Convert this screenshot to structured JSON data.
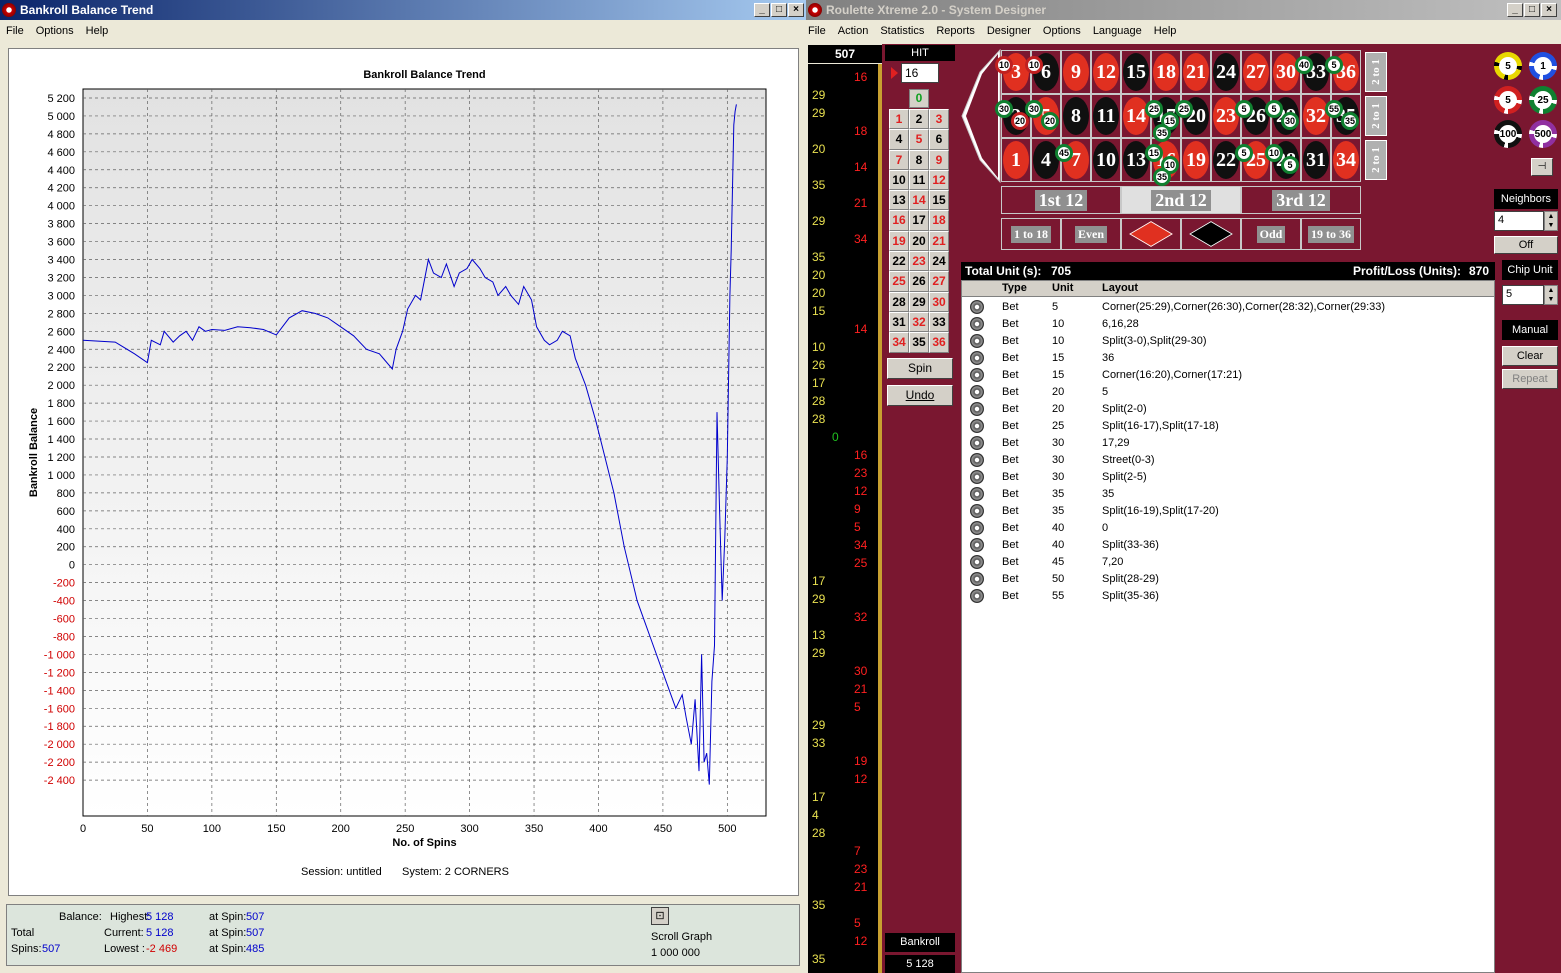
{
  "left_window": {
    "title": "Bankroll Balance Trend",
    "menu": [
      "File",
      "Options",
      "Help"
    ]
  },
  "chart_data": {
    "type": "line",
    "title": "Bankroll Balance Trend",
    "xlabel": "No. of Spins",
    "ylabel": "Bankroll Balance",
    "xlim": [
      0,
      530
    ],
    "ylim": [
      -2800,
      5300
    ],
    "xticks": [
      "0",
      "50",
      "100",
      "150",
      "200",
      "250",
      "300",
      "350",
      "400",
      "450",
      "500"
    ],
    "yticks": [
      "5 200",
      "5 000",
      "4 800",
      "4 600",
      "4 400",
      "4 200",
      "4 000",
      "3 800",
      "3 600",
      "3 400",
      "3 200",
      "3 000",
      "2 800",
      "2 600",
      "2 400",
      "2 200",
      "2 000",
      "1 800",
      "1 600",
      "1 400",
      "1 200",
      "1 000",
      "800",
      "600",
      "400",
      "200",
      "0",
      "-200",
      "-400",
      "-600",
      "-800",
      "-1 000",
      "-1 200",
      "-1 400",
      "-1 600",
      "-1 800",
      "-2 000",
      "-2 200",
      "-2 400"
    ],
    "ytick_values": [
      5200,
      5000,
      4800,
      4600,
      4400,
      4200,
      4000,
      3800,
      3600,
      3400,
      3200,
      3000,
      2800,
      2600,
      2400,
      2200,
      2000,
      1800,
      1600,
      1400,
      1200,
      1000,
      800,
      600,
      400,
      200,
      0,
      -200,
      -400,
      -600,
      -800,
      -1000,
      -1200,
      -1400,
      -1600,
      -1800,
      -2000,
      -2200,
      -2400
    ],
    "grid": true,
    "series": [
      {
        "color": "#0000cc",
        "x": [
          0,
          25,
          40,
          50,
          53,
          60,
          63,
          70,
          75,
          80,
          85,
          90,
          95,
          100,
          110,
          120,
          130,
          140,
          150,
          160,
          170,
          180,
          190,
          200,
          210,
          220,
          230,
          240,
          243,
          248,
          252,
          258,
          262,
          268,
          272,
          278,
          282,
          288,
          292,
          298,
          302,
          308,
          312,
          318,
          322,
          328,
          332,
          338,
          342,
          348,
          352,
          358,
          362,
          368,
          372,
          378,
          382,
          390,
          398,
          405,
          412,
          420,
          430,
          440,
          450,
          455,
          460,
          465,
          468,
          472,
          475,
          478,
          480,
          482,
          484,
          486,
          488,
          490,
          492,
          494,
          496,
          498,
          500,
          502,
          503,
          504,
          505,
          506,
          507
        ],
        "y": [
          2500,
          2480,
          2350,
          2250,
          2500,
          2450,
          2600,
          2480,
          2550,
          2600,
          2500,
          2650,
          2600,
          2620,
          2610,
          2650,
          2640,
          2620,
          2560,
          2750,
          2830,
          2800,
          2750,
          2650,
          2550,
          2400,
          2350,
          2180,
          2400,
          2600,
          2850,
          3000,
          2950,
          3400,
          3250,
          3200,
          3350,
          3100,
          3250,
          3300,
          3400,
          3300,
          3200,
          3150,
          3000,
          3100,
          3000,
          2900,
          3100,
          2950,
          2650,
          2500,
          2450,
          2500,
          2600,
          2550,
          2300,
          2000,
          1600,
          1200,
          800,
          200,
          -400,
          -800,
          -1200,
          -1400,
          -1600,
          -1450,
          -1700,
          -2000,
          -1500,
          -2300,
          -1000,
          -2200,
          -2100,
          -2450,
          -1300,
          -900,
          1700,
          600,
          -400,
          300,
          1200,
          3000,
          3500,
          4200,
          4900,
          5050,
          5128
        ]
      }
    ]
  },
  "session_line": {
    "session": "Session: untitled",
    "system": "System: 2 CORNERS"
  },
  "stats": {
    "balance_label": "Balance:",
    "highest_label": "Highest:",
    "highest": "5 128",
    "highest_at_label": "at Spin:",
    "highest_at": "507",
    "total_label": "Total",
    "current_label": "Current:",
    "current": "5 128",
    "current_at_label": "at Spin:",
    "current_at": "507",
    "spins_label": "Spins:",
    "spins": "507",
    "lowest_label": "Lowest :",
    "lowest": "-2 469",
    "lowest_at_label": "at Spin:",
    "lowest_at": "485",
    "scroll_label": "Scroll Graph",
    "scroll_value": "1 000 000"
  },
  "right_window": {
    "title": "Roulette Xtreme 2.0 - System Designer",
    "menu": [
      "File",
      "Action",
      "Statistics",
      "Reports",
      "Designer",
      "Options",
      "Language",
      "Help"
    ]
  },
  "spin_count": "507",
  "hit_label": "HIT",
  "hit_value": "16",
  "zero": "0",
  "numbers": [
    [
      "1",
      "2",
      "3"
    ],
    [
      "4",
      "5",
      "6"
    ],
    [
      "7",
      "8",
      "9"
    ],
    [
      "10",
      "11",
      "12"
    ],
    [
      "13",
      "14",
      "15"
    ],
    [
      "16",
      "17",
      "18"
    ],
    [
      "19",
      "20",
      "21"
    ],
    [
      "22",
      "23",
      "24"
    ],
    [
      "25",
      "26",
      "27"
    ],
    [
      "28",
      "29",
      "30"
    ],
    [
      "31",
      "32",
      "33"
    ],
    [
      "34",
      "35",
      "36"
    ]
  ],
  "red_numbers": [
    "1",
    "3",
    "5",
    "7",
    "9",
    "12",
    "14",
    "16",
    "18",
    "19",
    "21",
    "23",
    "25",
    "27",
    "30",
    "32",
    "34",
    "36"
  ],
  "spin_label": "Spin",
  "undo_label": "Undo",
  "bankroll_label": "Bankroll",
  "bankroll_value": "5 128",
  "history": [
    {
      "t": "16",
      "c": "r",
      "col": 2,
      "row": 0
    },
    {
      "t": "29",
      "c": "y",
      "col": 0,
      "row": 1
    },
    {
      "t": "29",
      "c": "y",
      "col": 0,
      "row": 2
    },
    {
      "t": "18",
      "c": "r",
      "col": 2,
      "row": 3
    },
    {
      "t": "20",
      "c": "y",
      "col": 0,
      "row": 4
    },
    {
      "t": "14",
      "c": "r",
      "col": 2,
      "row": 5
    },
    {
      "t": "35",
      "c": "y",
      "col": 0,
      "row": 6
    },
    {
      "t": "21",
      "c": "r",
      "col": 2,
      "row": 7
    },
    {
      "t": "29",
      "c": "y",
      "col": 0,
      "row": 8
    },
    {
      "t": "34",
      "c": "r",
      "col": 2,
      "row": 9
    },
    {
      "t": "35",
      "c": "y",
      "col": 0,
      "row": 10
    },
    {
      "t": "20",
      "c": "y",
      "col": 0,
      "row": 11
    },
    {
      "t": "20",
      "c": "y",
      "col": 0,
      "row": 12
    },
    {
      "t": "15",
      "c": "y",
      "col": 0,
      "row": 13
    },
    {
      "t": "14",
      "c": "r",
      "col": 2,
      "row": 14
    },
    {
      "t": "10",
      "c": "y",
      "col": 0,
      "row": 15
    },
    {
      "t": "26",
      "c": "y",
      "col": 0,
      "row": 16
    },
    {
      "t": "17",
      "c": "y",
      "col": 0,
      "row": 17
    },
    {
      "t": "28",
      "c": "y",
      "col": 0,
      "row": 18
    },
    {
      "t": "28",
      "c": "y",
      "col": 0,
      "row": 19
    },
    {
      "t": "0",
      "c": "g",
      "col": 1,
      "row": 20
    },
    {
      "t": "16",
      "c": "r",
      "col": 2,
      "row": 21
    },
    {
      "t": "23",
      "c": "r",
      "col": 2,
      "row": 22
    },
    {
      "t": "12",
      "c": "r",
      "col": 2,
      "row": 23
    },
    {
      "t": "9",
      "c": "r",
      "col": 2,
      "row": 24
    },
    {
      "t": "5",
      "c": "r",
      "col": 2,
      "row": 25
    },
    {
      "t": "34",
      "c": "r",
      "col": 2,
      "row": 26
    },
    {
      "t": "25",
      "c": "r",
      "col": 2,
      "row": 27
    },
    {
      "t": "17",
      "c": "y",
      "col": 0,
      "row": 28
    },
    {
      "t": "29",
      "c": "y",
      "col": 0,
      "row": 29
    },
    {
      "t": "32",
      "c": "r",
      "col": 2,
      "row": 30
    },
    {
      "t": "13",
      "c": "y",
      "col": 0,
      "row": 31
    },
    {
      "t": "29",
      "c": "y",
      "col": 0,
      "row": 32
    },
    {
      "t": "30",
      "c": "r",
      "col": 2,
      "row": 33
    },
    {
      "t": "21",
      "c": "r",
      "col": 2,
      "row": 34
    },
    {
      "t": "5",
      "c": "r",
      "col": 2,
      "row": 35
    },
    {
      "t": "29",
      "c": "y",
      "col": 0,
      "row": 36
    },
    {
      "t": "33",
      "c": "y",
      "col": 0,
      "row": 37
    },
    {
      "t": "19",
      "c": "r",
      "col": 2,
      "row": 38
    },
    {
      "t": "12",
      "c": "r",
      "col": 2,
      "row": 39
    },
    {
      "t": "17",
      "c": "y",
      "col": 0,
      "row": 40
    },
    {
      "t": "4",
      "c": "y",
      "col": 0,
      "row": 41
    },
    {
      "t": "28",
      "c": "y",
      "col": 0,
      "row": 42
    },
    {
      "t": "7",
      "c": "r",
      "col": 2,
      "row": 43
    },
    {
      "t": "23",
      "c": "r",
      "col": 2,
      "row": 44
    },
    {
      "t": "21",
      "c": "r",
      "col": 2,
      "row": 45
    },
    {
      "t": "35",
      "c": "y",
      "col": 0,
      "row": 46
    },
    {
      "t": "5",
      "c": "r",
      "col": 2,
      "row": 47
    },
    {
      "t": "12",
      "c": "r",
      "col": 2,
      "row": 48
    },
    {
      "t": "35",
      "c": "y",
      "col": 0,
      "row": 49
    }
  ],
  "layout_rows": [
    [
      "3",
      "6",
      "9",
      "12",
      "15",
      "18",
      "21",
      "24",
      "27",
      "30",
      "33",
      "36"
    ],
    [
      "2",
      "5",
      "8",
      "11",
      "14",
      "17",
      "20",
      "23",
      "26",
      "29",
      "32",
      "35"
    ],
    [
      "1",
      "4",
      "7",
      "10",
      "13",
      "16",
      "19",
      "22",
      "25",
      "28",
      "31",
      "34"
    ]
  ],
  "two_to_one": [
    "2 to 1",
    "2 to 1",
    "2 to 1"
  ],
  "dozens": [
    "1st 12",
    "2nd 12",
    "3rd 12"
  ],
  "outside": [
    "1 to 18",
    "Even",
    "Odd",
    "19 to 36"
  ],
  "chips": [
    "5",
    "1",
    "5",
    "25",
    "100",
    "500"
  ],
  "neighbors_label": "Neighbors",
  "neighbors_value": "4",
  "off_label": "Off",
  "chip_unit_label": "Chip Unit",
  "chip_unit_value": "5",
  "manual_label": "Manual",
  "clear_label": "Clear",
  "repeat_label": "Repeat",
  "total_units_label": "Total Unit (s):",
  "total_units": "705",
  "profit_label": "Profit/Loss (Units):",
  "profit": "870",
  "bet_columns": [
    "Type",
    "Unit",
    "Layout"
  ],
  "bets": [
    {
      "type": "Bet",
      "unit": "5",
      "layout": "Corner(25:29),Corner(26:30),Corner(28:32),Corner(29:33)"
    },
    {
      "type": "Bet",
      "unit": "10",
      "layout": "6,16,28"
    },
    {
      "type": "Bet",
      "unit": "10",
      "layout": "Split(3-0),Split(29-30)"
    },
    {
      "type": "Bet",
      "unit": "15",
      "layout": "36"
    },
    {
      "type": "Bet",
      "unit": "15",
      "layout": "Corner(16:20),Corner(17:21)"
    },
    {
      "type": "Bet",
      "unit": "20",
      "layout": "5"
    },
    {
      "type": "Bet",
      "unit": "20",
      "layout": "Split(2-0)"
    },
    {
      "type": "Bet",
      "unit": "25",
      "layout": "Split(16-17),Split(17-18)"
    },
    {
      "type": "Bet",
      "unit": "30",
      "layout": "17,29"
    },
    {
      "type": "Bet",
      "unit": "30",
      "layout": "Street(0-3)"
    },
    {
      "type": "Bet",
      "unit": "30",
      "layout": "Split(2-5)"
    },
    {
      "type": "Bet",
      "unit": "35",
      "layout": "35"
    },
    {
      "type": "Bet",
      "unit": "35",
      "layout": "Split(16-19),Split(17-20)"
    },
    {
      "type": "Bet",
      "unit": "40",
      "layout": "0"
    },
    {
      "type": "Bet",
      "unit": "40",
      "layout": "Split(33-36)"
    },
    {
      "type": "Bet",
      "unit": "45",
      "layout": "7,20"
    },
    {
      "type": "Bet",
      "unit": "50",
      "layout": "Split(28-29)"
    },
    {
      "type": "Bet",
      "unit": "55",
      "layout": "Split(35-36)"
    }
  ],
  "table_chips": [
    {
      "t": "10",
      "c": 0,
      "r": 0,
      "s": "sm"
    },
    {
      "t": "10",
      "c": 1,
      "r": 0,
      "s": "sm"
    },
    {
      "t": "40",
      "c": 10,
      "r": 0,
      "s": ""
    },
    {
      "t": "5",
      "c": 11,
      "r": 0,
      "s": ""
    },
    {
      "t": "30",
      "c": 0,
      "r": 1,
      "s": ""
    },
    {
      "t": "20",
      "c": 0,
      "r": 1,
      "s": "sm"
    },
    {
      "t": "30",
      "c": 1,
      "r": 1,
      "s": ""
    },
    {
      "t": "20",
      "c": 1,
      "r": 1,
      "s": ""
    },
    {
      "t": "25",
      "c": 5,
      "r": 1,
      "s": ""
    },
    {
      "t": "15",
      "c": 5,
      "r": 1,
      "s": ""
    },
    {
      "t": "35",
      "c": 5,
      "r": 1,
      "s": ""
    },
    {
      "t": "25",
      "c": 6,
      "r": 1,
      "s": ""
    },
    {
      "t": "5",
      "c": 8,
      "r": 1,
      "s": ""
    },
    {
      "t": "5",
      "c": 9,
      "r": 1,
      "s": ""
    },
    {
      "t": "30",
      "c": 9,
      "r": 1,
      "s": ""
    },
    {
      "t": "55",
      "c": 11,
      "r": 1,
      "s": ""
    },
    {
      "t": "35",
      "c": 11,
      "r": 1,
      "s": ""
    },
    {
      "t": "45",
      "c": 2,
      "r": 2,
      "s": ""
    },
    {
      "t": "15",
      "c": 5,
      "r": 2,
      "s": ""
    },
    {
      "t": "10",
      "c": 5,
      "r": 2,
      "s": ""
    },
    {
      "t": "35",
      "c": 5,
      "r": 2,
      "s": ""
    },
    {
      "t": "10",
      "c": 9,
      "r": 2,
      "s": ""
    },
    {
      "t": "5",
      "c": 8,
      "r": 2,
      "s": ""
    },
    {
      "t": "5",
      "c": 9,
      "r": 2,
      "s": ""
    }
  ],
  "colors": {
    "red": "#e03020",
    "black": "#101010",
    "green": "#108030",
    "felt": "#7a1730",
    "line": "#0000cc"
  }
}
